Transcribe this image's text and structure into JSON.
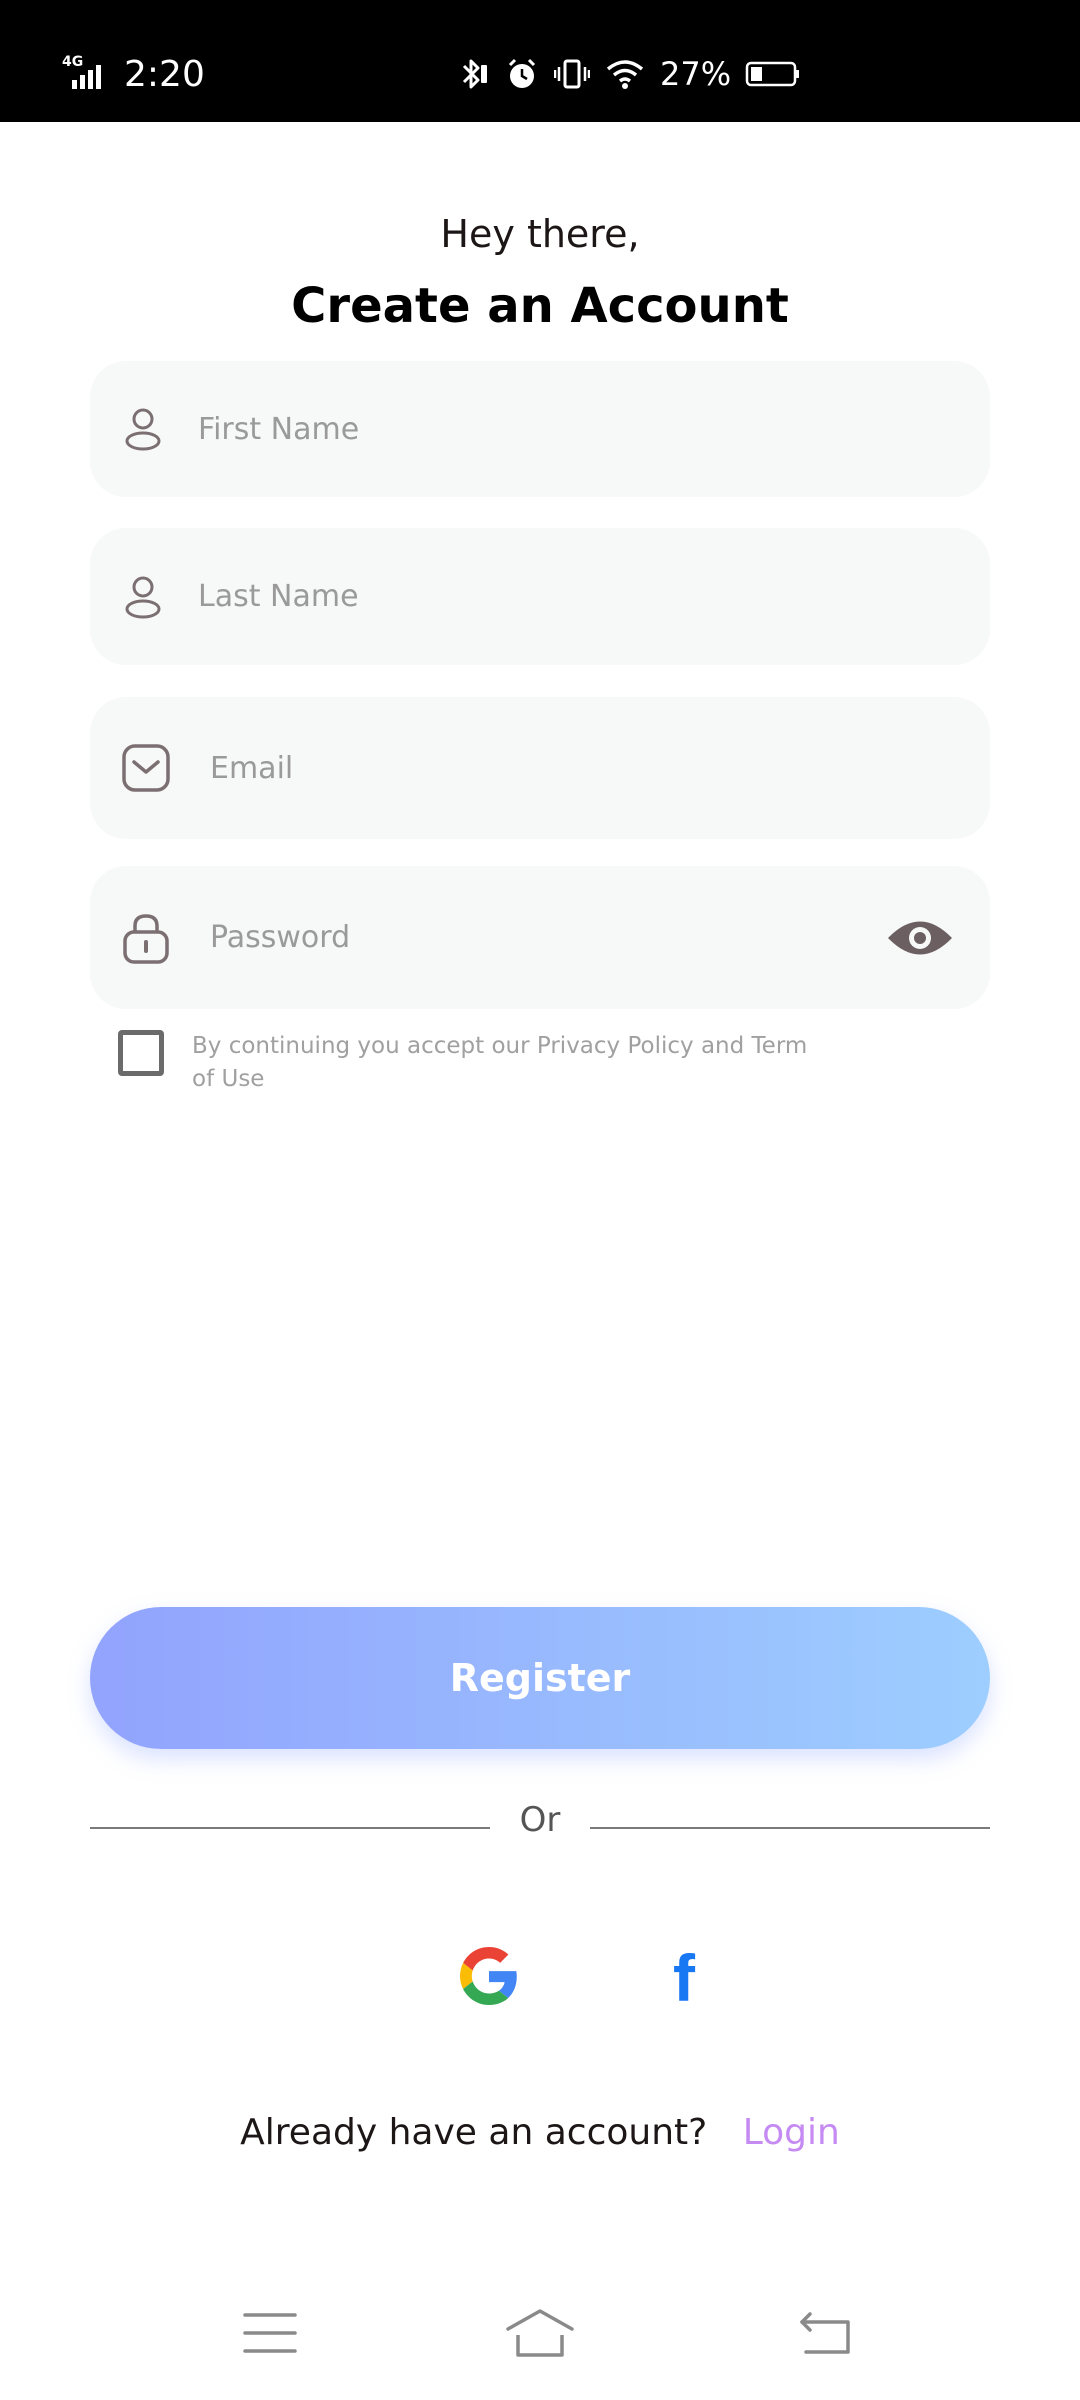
{
  "status_bar": {
    "network": "4G",
    "time": "2:20",
    "battery": "27%",
    "icons": [
      "signal-icon",
      "bluetooth-icon",
      "alarm-icon",
      "vibrate-icon",
      "wifi-icon",
      "battery-icon"
    ]
  },
  "header": {
    "greeting": "Hey there,",
    "title": "Create an Account"
  },
  "form": {
    "first_name": {
      "placeholder": "First Name",
      "value": "",
      "icon": "user-icon"
    },
    "last_name": {
      "placeholder": "Last Name",
      "value": "",
      "icon": "user-icon"
    },
    "email": {
      "placeholder": "Email",
      "value": "",
      "icon": "mail-icon"
    },
    "password": {
      "placeholder": "Password",
      "value": "",
      "icon": "lock-icon",
      "toggle_icon": "eye-icon"
    },
    "terms": {
      "checked": false,
      "text": "By continuing you accept our Privacy Policy and Term of Use"
    }
  },
  "register_label": "Register",
  "divider_label": "Or",
  "social": [
    "google-icon",
    "facebook-icon"
  ],
  "login": {
    "question": "Already have an account?",
    "link": "Login"
  },
  "colors": {
    "gradient_start": "#92A3FD",
    "gradient_end": "#9DCEFF",
    "login_link": "#C58BF2",
    "field_bg": "#F7F8F8",
    "placeholder": "#9A9A9A"
  },
  "nav": [
    "menu-icon",
    "home-icon",
    "back-icon"
  ]
}
